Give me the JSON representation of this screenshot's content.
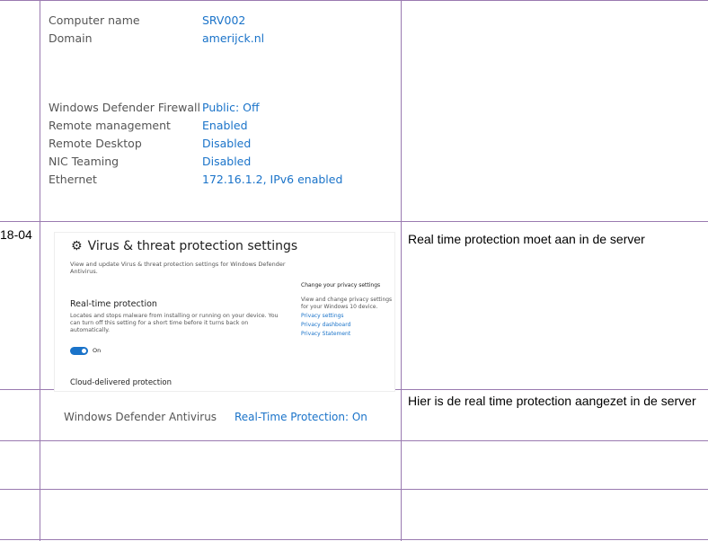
{
  "table": {
    "row_date": "18-04",
    "note_realtime": "Real time protection moet aan in de server",
    "note_done": "Hier is de real time protection aangezet in de server"
  },
  "server_properties": [
    {
      "label": "Computer name",
      "value": "SRV002"
    },
    {
      "label": "Domain",
      "value": "amerijck.nl"
    },
    {
      "label": "Windows Defender Firewall",
      "value": "Public: Off"
    },
    {
      "label": "Remote management",
      "value": "Enabled"
    },
    {
      "label": "Remote Desktop",
      "value": "Disabled"
    },
    {
      "label": "NIC Teaming",
      "value": "Disabled"
    },
    {
      "label": "Ethernet",
      "value": "172.16.1.2, IPv6 enabled"
    }
  ],
  "virus_panel": {
    "gear_glyph": "⚙",
    "title": "Virus & threat protection settings",
    "description": "View and update Virus & threat protection settings for Windows Defender Antivirus.",
    "realtime_heading": "Real-time protection",
    "realtime_text": "Locates and stops malware from installing or running on your device. You can turn off this setting for a short time before it turns back on automatically.",
    "toggle_label": "On",
    "toggle_on": true,
    "cloud_heading": "Cloud-delivered protection",
    "privacy_heading": "Change your privacy settings",
    "privacy_text": "View and change privacy settings for your Windows 10 device.",
    "privacy_links": [
      "Privacy settings",
      "Privacy dashboard",
      "Privacy Statement"
    ]
  },
  "antivirus_row": {
    "label": "Windows Defender Antivirus",
    "value": "Real-Time Protection: On"
  },
  "colors": {
    "grid": "#9a7ab0",
    "link": "#1a73c9"
  }
}
